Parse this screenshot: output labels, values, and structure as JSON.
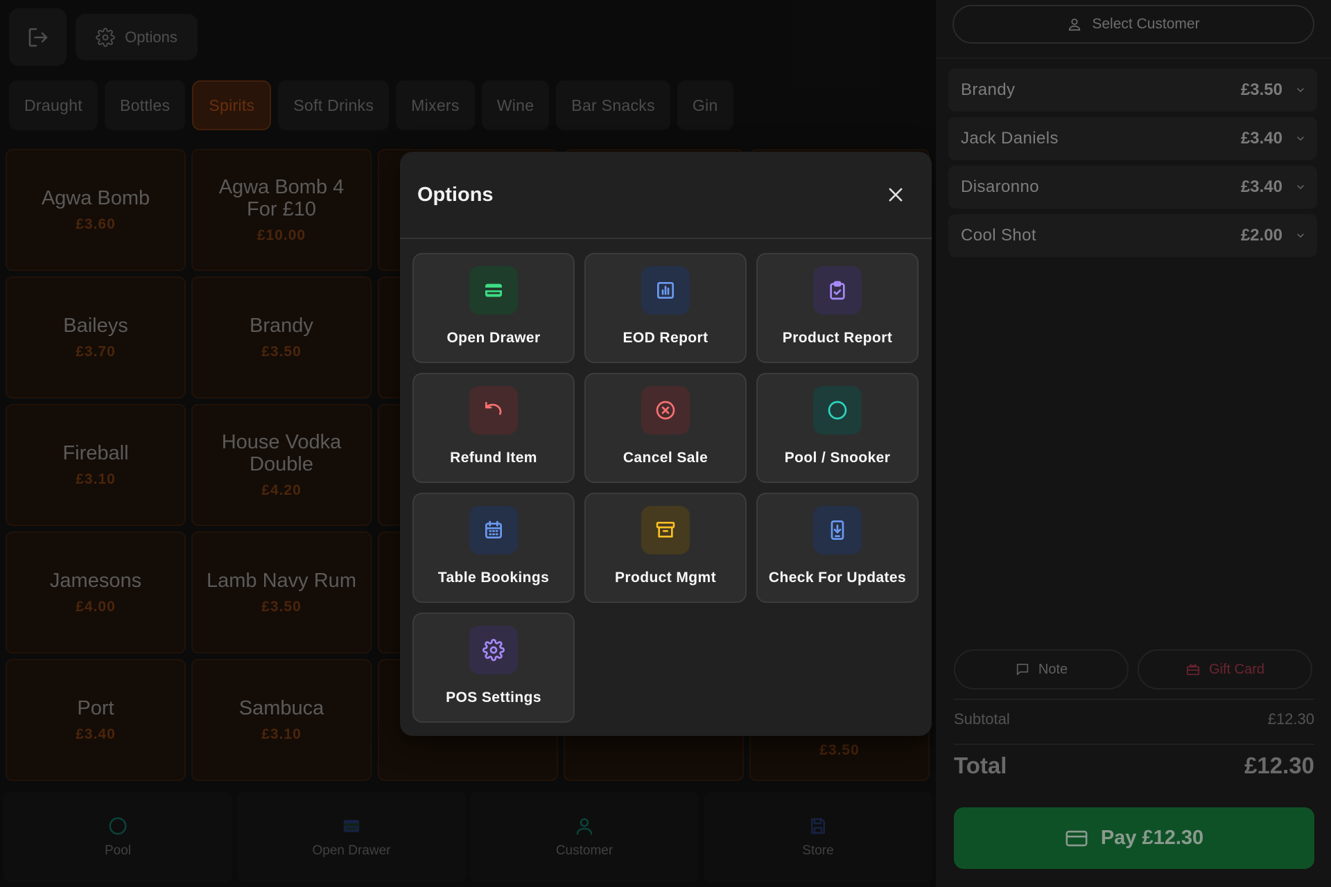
{
  "header": {
    "options_label": "Options"
  },
  "categories": [
    {
      "label": "Draught",
      "active": false
    },
    {
      "label": "Bottles",
      "active": false
    },
    {
      "label": "Spirits",
      "active": true
    },
    {
      "label": "Soft Drinks",
      "active": false
    },
    {
      "label": "Mixers",
      "active": false
    },
    {
      "label": "Wine",
      "active": false
    },
    {
      "label": "Bar Snacks",
      "active": false
    },
    {
      "label": "Gin",
      "active": false
    }
  ],
  "products": [
    {
      "name": "Agwa Bomb",
      "price": "£3.60"
    },
    {
      "name": "Agwa Bomb 4 For £10",
      "price": "£10.00"
    },
    {
      "name": "Baileys",
      "price": "£3.70"
    },
    {
      "name": "Brandy",
      "price": "£3.50"
    },
    {
      "name": "Fireball",
      "price": "£3.10"
    },
    {
      "name": "House Vodka Double",
      "price": "£4.20"
    },
    {
      "name": "Jamesons",
      "price": "£4.00"
    },
    {
      "name": "Lamb Navy Rum",
      "price": "£3.50"
    },
    {
      "name": "Port",
      "price": "£3.40"
    },
    {
      "name": "Sambuca",
      "price": "£3.10"
    },
    {
      "name": "",
      "price": "£3.50"
    }
  ],
  "bottom_bar": [
    {
      "label": "Pool",
      "icon": "circle-icon",
      "color": "#137a6a"
    },
    {
      "label": "Open Drawer",
      "icon": "wallet-icon",
      "color": "#2b3f78"
    },
    {
      "label": "Customer",
      "icon": "user-icon",
      "color": "#137a6a"
    },
    {
      "label": "Store",
      "icon": "save-icon",
      "color": "#2b3f78"
    }
  ],
  "modal": {
    "title": "Options",
    "options": [
      {
        "label": "Open Drawer",
        "icon": "wallet-icon",
        "color": "#3ddc84",
        "bg": "#1f3d2b"
      },
      {
        "label": "EOD Report",
        "icon": "chart-icon",
        "color": "#6b9bf2",
        "bg": "#253049"
      },
      {
        "label": "Product Report",
        "icon": "clipboard-check-icon",
        "color": "#a78bfa",
        "bg": "#342d48"
      },
      {
        "label": "Refund Item",
        "icon": "undo-icon",
        "color": "#f87171",
        "bg": "#472a2c"
      },
      {
        "label": "Cancel Sale",
        "icon": "x-circle-icon",
        "color": "#f87171",
        "bg": "#472a2c"
      },
      {
        "label": "Pool / Snooker",
        "icon": "circle-icon",
        "color": "#2dd4bf",
        "bg": "#1c3d39"
      },
      {
        "label": "Table Bookings",
        "icon": "calendar-icon",
        "color": "#6b9bf2",
        "bg": "#253049"
      },
      {
        "label": "Product Mgmt",
        "icon": "archive-icon",
        "color": "#fbbf24",
        "bg": "#463a1f"
      },
      {
        "label": "Check For Updates",
        "icon": "phone-download-icon",
        "color": "#6b9bf2",
        "bg": "#253049"
      },
      {
        "label": "POS Settings",
        "icon": "gear-icon",
        "color": "#a78bfa",
        "bg": "#342d48"
      }
    ]
  },
  "order": {
    "select_customer_label": "Select Customer",
    "items": [
      {
        "name": "Brandy",
        "price": "£3.50"
      },
      {
        "name": "Jack Daniels",
        "price": "£3.40"
      },
      {
        "name": "Disaronno",
        "price": "£3.40"
      },
      {
        "name": "Cool Shot",
        "price": "£2.00"
      }
    ],
    "note_label": "Note",
    "gift_card_label": "Gift Card",
    "subtotal_label": "Subtotal",
    "subtotal_value": "£12.30",
    "total_label": "Total",
    "total_value": "£12.30",
    "pay_label": "Pay £12.30"
  },
  "colors": {
    "accent": "#c2541c",
    "pay_green": "#0f5126"
  }
}
